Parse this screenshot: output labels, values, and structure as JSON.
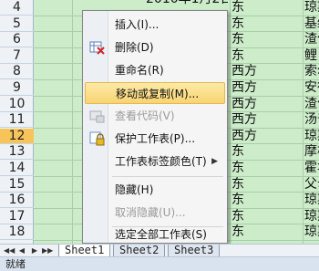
{
  "grid": {
    "row_numbers": [
      "4",
      "5",
      "6",
      "7",
      "8",
      "9",
      "10",
      "11",
      "12",
      "13",
      "14",
      "15",
      "16",
      "17",
      "18"
    ],
    "selected_row": "12",
    "partial_top_text": "2010年1月2日",
    "col_c": [
      "东",
      "东",
      "东",
      "东",
      "西方",
      "西方",
      "西方",
      "西方",
      "西方",
      "东",
      "东",
      "东",
      "东",
      "东",
      "东"
    ],
    "col_d": [
      "琼斯",
      "基维",
      "渣甸",
      "鲤",
      "索尔",
      "安德",
      "渣甸",
      "汤普",
      "琼斯",
      "摩根",
      "霍华",
      "父母",
      "琼斯",
      "琼斯",
      "琼斯"
    ],
    "col_c_top": "东",
    "col_d_top": "琼斯"
  },
  "context_menu": {
    "items": [
      {
        "label": "插入(I)...",
        "disabled": false
      },
      {
        "label": "删除(D)",
        "disabled": false
      },
      {
        "label": "重命名(R)",
        "disabled": false
      },
      {
        "label": "移动或复制(M)...",
        "disabled": false,
        "highlight": true
      },
      {
        "label": "查看代码(V)",
        "disabled": true
      },
      {
        "label": "保护工作表(P)...",
        "disabled": false
      },
      {
        "label": "工作表标签颜色(T)",
        "disabled": false,
        "submenu": true
      },
      {
        "label": "隐藏(H)",
        "disabled": false
      },
      {
        "label": "取消隐藏(U)...",
        "disabled": true
      },
      {
        "label": "选定全部工作表(S)",
        "disabled": false
      }
    ],
    "icons": [
      "none",
      "delete-sheet-icon",
      "none",
      "none",
      "view-code-icon",
      "protect-sheet-icon",
      "none",
      "none",
      "none",
      "none"
    ],
    "submenu_arrow": "▶"
  },
  "tabs": {
    "nav": [
      "◀◀",
      "◀",
      "▶",
      "▶▶"
    ],
    "sheets": [
      "Sheet1",
      "Sheet2",
      "Sheet3"
    ],
    "active": "Sheet1"
  },
  "status": {
    "text": "就绪"
  },
  "colors": {
    "grid_fill": "#ccecca",
    "selected_row_header": "#f7c45a",
    "menu_highlight": "#f8d472"
  }
}
